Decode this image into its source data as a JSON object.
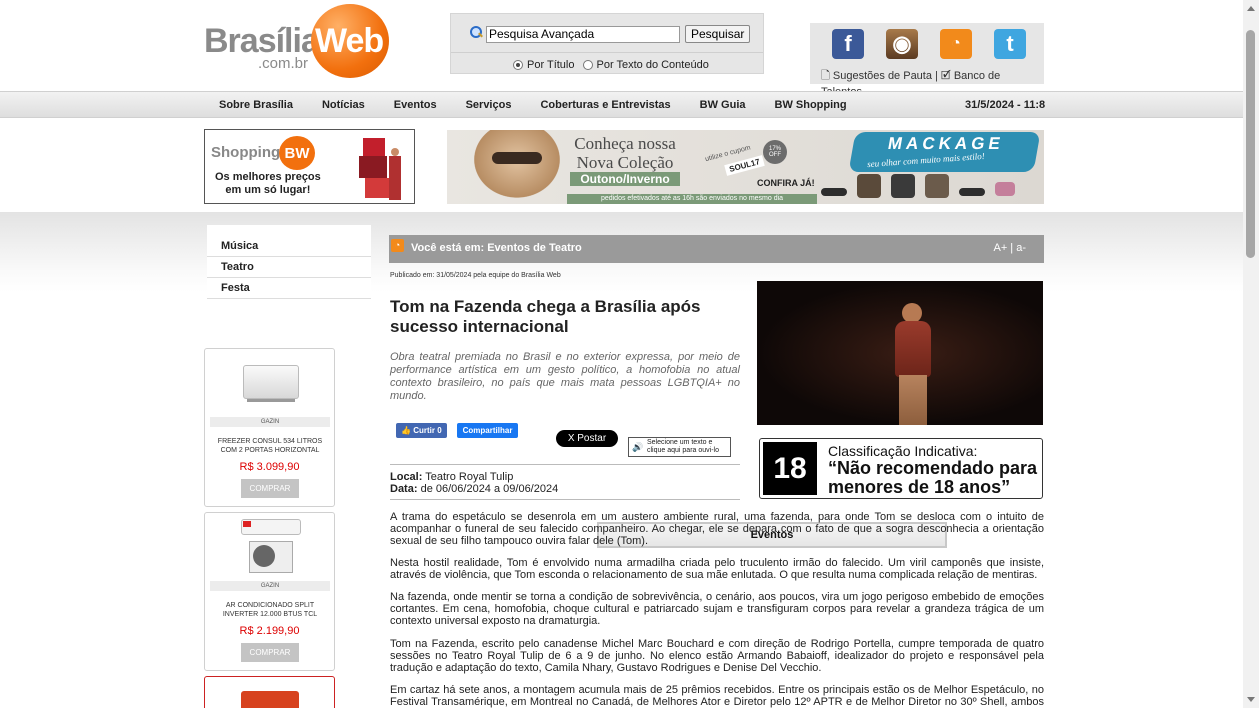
{
  "header": {
    "logo": {
      "brand": "Brasília",
      "web": "Web",
      "com": ".com.br"
    },
    "search": {
      "value": "Pesquisa Avançada",
      "button": "Pesquisar",
      "radio_title": "Por Título",
      "radio_content": "Por Texto do Conteúdo"
    },
    "social": {
      "links_text": "🗋 Sugestões de Pauta | 🗹 Banco de Talentos",
      "icons": [
        "facebook-icon",
        "instagram-icon",
        "rss-icon",
        "twitter-icon"
      ]
    }
  },
  "nav": {
    "items": [
      "Sobre Brasília",
      "Notícias",
      "Eventos",
      "Serviços",
      "Coberturas e Entrevistas",
      "BW Guia",
      "BW Shopping"
    ],
    "datetime": "31/5/2024 - 11:8"
  },
  "ads": {
    "shopping": {
      "title": "Shopping",
      "badge": "BW",
      "tagline1": "Os melhores preços",
      "tagline2": "em um só lugar!"
    },
    "banner": {
      "headline": "Conheça nossa Nova Coleção",
      "season": "Outono/Inverno",
      "strip": "pedidos efetivados até as 16h são enviados no mesmo dia",
      "coupon": "utilize o cupom",
      "code": "SOUL17",
      "off": "17% OFF",
      "cta": "CONFIRA JÁ!",
      "brand": "MACKAGE",
      "slogan": "seu olhar com muito mais estilo!"
    }
  },
  "sidebar": {
    "title": "Eventos",
    "items": [
      "Música",
      "Teatro",
      "Festa"
    ],
    "products": [
      {
        "brand": "GAZIN",
        "name": "FREEZER CONSUL 534 LITROS COM 2 PORTAS HORIZONTAL",
        "price": "R$ 3.099,90",
        "buy": "COMPRAR"
      },
      {
        "brand": "GAZIN",
        "name": "AR CONDICIONADO SPLIT INVERTER 12.000 BTUS TCL",
        "price": "R$ 2.199,90",
        "buy": "COMPRAR"
      }
    ]
  },
  "content": {
    "breadcrumb": "Você está em: Eventos de Teatro",
    "font_controls": "A+ | a-",
    "published": "Publicado em: 31/05/2024 pela equipe do Brasília Web",
    "title": "Tom na Fazenda chega a Brasília após sucesso internacional",
    "lead": "Obra teatral premiada no Brasil e no exterior expressa, por meio de performance artística em um gesto político, a homofobia no atual contexto brasileiro, no país que mais mata pessoas LGBTQIA+ no mundo.",
    "share": {
      "like": "Curtir 0",
      "share": "Compartilhar",
      "post": "X Postar",
      "audio": "Selecione um texto e clique aqui para ouvi-lo"
    },
    "local_label": "Local:",
    "local": "Teatro Royal Tulip",
    "date_label": "Data:",
    "date": "de 06/06/2024 a 09/06/2024",
    "rating": {
      "age": "18",
      "label": "Classificação Indicativa:",
      "text": "“Não recomendado para menores de 18 anos”"
    },
    "paragraphs": [
      "A trama do espetáculo se desenrola em um austero ambiente rural, uma fazenda, para onde Tom se desloca com o intuito de acompanhar o funeral de seu falecido companheiro. Ao chegar, ele se depara com o fato de que a sogra desconhecia a orientação sexual de seu filho tampouco ouvira falar dele (Tom).",
      "Nesta hostil realidade, Tom é envolvido numa armadilha criada pelo truculento irmão do falecido. Um viril camponês que insiste, através de violência, que Tom esconda o relacionamento de sua mãe enlutada. O que resulta numa complicada relação de mentiras.",
      "Na fazenda, onde mentir se torna a condição de sobrevivência, o cenário, aos poucos, vira um jogo perigoso embebido de emoções cortantes. Em cena, homofobia, choque cultural e patriarcado sujam e transfiguram corpos para revelar a grandeza trágica de um contexto universal exposto na dramaturgia.",
      "Tom na Fazenda, escrito pelo canadense Michel Marc Bouchard e com direção de Rodrigo Portella, cumpre temporada de quatro sessões no Teatro Royal Tulip de 6 a 9 de junho. No elenco estão Armando Babaioff, idealizador do projeto e responsável pela tradução e adaptação do texto, Camila Nhary, Gustavo Rodrigues e Denise Del Vecchio.",
      "Em cartaz há sete anos, a montagem acumula mais de 25 prêmios recebidos. Entre os principais estão os de Melhor Espetáculo, no Festival Transamérique, em Montreal no Canadá, de Melhores Ator e Diretor pelo 12º APTR e de Melhor Diretor no 30º Shell, ambos na"
    ]
  }
}
